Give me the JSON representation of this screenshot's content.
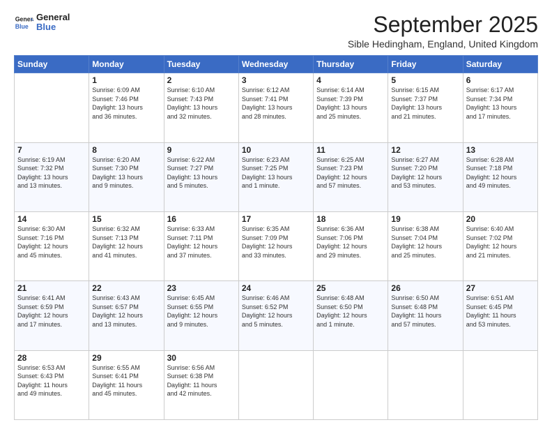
{
  "logo": {
    "line1": "General",
    "line2": "Blue"
  },
  "title": "September 2025",
  "location": "Sible Hedingham, England, United Kingdom",
  "days_of_week": [
    "Sunday",
    "Monday",
    "Tuesday",
    "Wednesday",
    "Thursday",
    "Friday",
    "Saturday"
  ],
  "weeks": [
    [
      {
        "num": "",
        "info": ""
      },
      {
        "num": "1",
        "info": "Sunrise: 6:09 AM\nSunset: 7:46 PM\nDaylight: 13 hours\nand 36 minutes."
      },
      {
        "num": "2",
        "info": "Sunrise: 6:10 AM\nSunset: 7:43 PM\nDaylight: 13 hours\nand 32 minutes."
      },
      {
        "num": "3",
        "info": "Sunrise: 6:12 AM\nSunset: 7:41 PM\nDaylight: 13 hours\nand 28 minutes."
      },
      {
        "num": "4",
        "info": "Sunrise: 6:14 AM\nSunset: 7:39 PM\nDaylight: 13 hours\nand 25 minutes."
      },
      {
        "num": "5",
        "info": "Sunrise: 6:15 AM\nSunset: 7:37 PM\nDaylight: 13 hours\nand 21 minutes."
      },
      {
        "num": "6",
        "info": "Sunrise: 6:17 AM\nSunset: 7:34 PM\nDaylight: 13 hours\nand 17 minutes."
      }
    ],
    [
      {
        "num": "7",
        "info": "Sunrise: 6:19 AM\nSunset: 7:32 PM\nDaylight: 13 hours\nand 13 minutes."
      },
      {
        "num": "8",
        "info": "Sunrise: 6:20 AM\nSunset: 7:30 PM\nDaylight: 13 hours\nand 9 minutes."
      },
      {
        "num": "9",
        "info": "Sunrise: 6:22 AM\nSunset: 7:27 PM\nDaylight: 13 hours\nand 5 minutes."
      },
      {
        "num": "10",
        "info": "Sunrise: 6:23 AM\nSunset: 7:25 PM\nDaylight: 13 hours\nand 1 minute."
      },
      {
        "num": "11",
        "info": "Sunrise: 6:25 AM\nSunset: 7:23 PM\nDaylight: 12 hours\nand 57 minutes."
      },
      {
        "num": "12",
        "info": "Sunrise: 6:27 AM\nSunset: 7:20 PM\nDaylight: 12 hours\nand 53 minutes."
      },
      {
        "num": "13",
        "info": "Sunrise: 6:28 AM\nSunset: 7:18 PM\nDaylight: 12 hours\nand 49 minutes."
      }
    ],
    [
      {
        "num": "14",
        "info": "Sunrise: 6:30 AM\nSunset: 7:16 PM\nDaylight: 12 hours\nand 45 minutes."
      },
      {
        "num": "15",
        "info": "Sunrise: 6:32 AM\nSunset: 7:13 PM\nDaylight: 12 hours\nand 41 minutes."
      },
      {
        "num": "16",
        "info": "Sunrise: 6:33 AM\nSunset: 7:11 PM\nDaylight: 12 hours\nand 37 minutes."
      },
      {
        "num": "17",
        "info": "Sunrise: 6:35 AM\nSunset: 7:09 PM\nDaylight: 12 hours\nand 33 minutes."
      },
      {
        "num": "18",
        "info": "Sunrise: 6:36 AM\nSunset: 7:06 PM\nDaylight: 12 hours\nand 29 minutes."
      },
      {
        "num": "19",
        "info": "Sunrise: 6:38 AM\nSunset: 7:04 PM\nDaylight: 12 hours\nand 25 minutes."
      },
      {
        "num": "20",
        "info": "Sunrise: 6:40 AM\nSunset: 7:02 PM\nDaylight: 12 hours\nand 21 minutes."
      }
    ],
    [
      {
        "num": "21",
        "info": "Sunrise: 6:41 AM\nSunset: 6:59 PM\nDaylight: 12 hours\nand 17 minutes."
      },
      {
        "num": "22",
        "info": "Sunrise: 6:43 AM\nSunset: 6:57 PM\nDaylight: 12 hours\nand 13 minutes."
      },
      {
        "num": "23",
        "info": "Sunrise: 6:45 AM\nSunset: 6:55 PM\nDaylight: 12 hours\nand 9 minutes."
      },
      {
        "num": "24",
        "info": "Sunrise: 6:46 AM\nSunset: 6:52 PM\nDaylight: 12 hours\nand 5 minutes."
      },
      {
        "num": "25",
        "info": "Sunrise: 6:48 AM\nSunset: 6:50 PM\nDaylight: 12 hours\nand 1 minute."
      },
      {
        "num": "26",
        "info": "Sunrise: 6:50 AM\nSunset: 6:48 PM\nDaylight: 11 hours\nand 57 minutes."
      },
      {
        "num": "27",
        "info": "Sunrise: 6:51 AM\nSunset: 6:45 PM\nDaylight: 11 hours\nand 53 minutes."
      }
    ],
    [
      {
        "num": "28",
        "info": "Sunrise: 6:53 AM\nSunset: 6:43 PM\nDaylight: 11 hours\nand 49 minutes."
      },
      {
        "num": "29",
        "info": "Sunrise: 6:55 AM\nSunset: 6:41 PM\nDaylight: 11 hours\nand 45 minutes."
      },
      {
        "num": "30",
        "info": "Sunrise: 6:56 AM\nSunset: 6:38 PM\nDaylight: 11 hours\nand 42 minutes."
      },
      {
        "num": "",
        "info": ""
      },
      {
        "num": "",
        "info": ""
      },
      {
        "num": "",
        "info": ""
      },
      {
        "num": "",
        "info": ""
      }
    ]
  ]
}
